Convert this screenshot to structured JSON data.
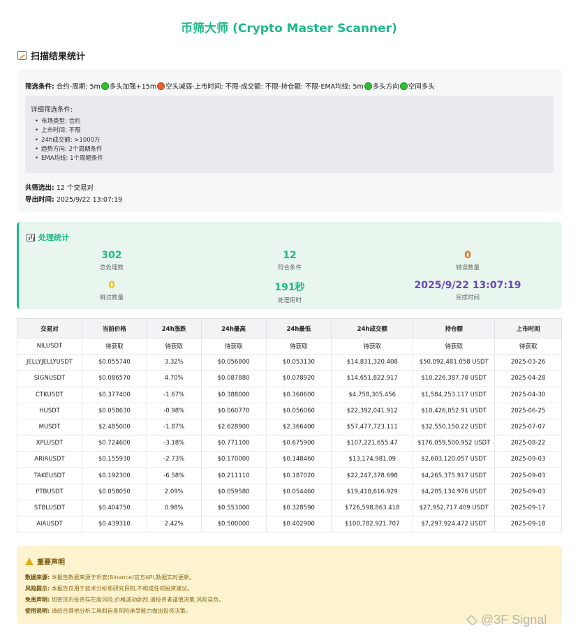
{
  "title": "币筛大师 (Crypto Master Scanner)",
  "section_title": "扫描结果统计",
  "filter": {
    "label": "筛选条件:",
    "part1": " 合约-周期: 5m",
    "part2": "多头加强+15m",
    "part3": "空头减弱-上市时间: 不限-成交额: 不限-持仓额: 不限-EMA均线: 5m",
    "part4": "多头方向",
    "part5": "空间多头"
  },
  "detail": {
    "title": "详细筛选条件:",
    "items": [
      "市场类型: 合约",
      "上市时间: 不限",
      "24h成交额: >1000万",
      "趋势方向: 2个周期条件",
      "EMA均线: 1个周期条件"
    ]
  },
  "summary": {
    "total_label": "共筛选出:",
    "total_value": " 12 个交易对",
    "export_label": "导出时间:",
    "export_value": " 2025/9/22 13:07:19"
  },
  "processing": {
    "title": "处理统计",
    "metrics": [
      {
        "value": "302",
        "label": "总处理数",
        "color": "#1db98a"
      },
      {
        "value": "12",
        "label": "符合条件",
        "color": "#1db98a"
      },
      {
        "value": "0",
        "label": "错误数量",
        "color": "#e0701e"
      },
      {
        "value": "0",
        "label": "跳过数量",
        "color": "#f0c419"
      },
      {
        "value": "191秒",
        "label": "处理用时",
        "color": "#1db98a"
      },
      {
        "value": "2025/9/22 13:07:19",
        "label": "完成时间",
        "color": "#6a47b8"
      }
    ]
  },
  "table": {
    "headers": [
      "交易对",
      "当前价格",
      "24h涨跌",
      "24h最高",
      "24h最低",
      "24h成交额",
      "持仓额",
      "上市时间"
    ],
    "rows": [
      [
        "NILUSDT",
        "待获取",
        "待获取",
        "待获取",
        "待获取",
        "待获取",
        "待获取",
        "待获取"
      ],
      [
        "JELLYJELLYUSDT",
        "$0.055740",
        "3.32%",
        "$0.056800",
        "$0.053130",
        "$14,831,320.408",
        "$50,092,481.058 USDT",
        "2025-03-26"
      ],
      [
        "SIGNUSDT",
        "$0.086570",
        "4.70%",
        "$0.087880",
        "$0.078920",
        "$14,651,822.917",
        "$10,226,387.78 USDT",
        "2025-04-28"
      ],
      [
        "CTKUSDT",
        "$0.377400",
        "-1.67%",
        "$0.388000",
        "$0.360600",
        "$4,758,305.456",
        "$1,584,253.117 USDT",
        "2025-04-30"
      ],
      [
        "HUSDT",
        "$0.058630",
        "-0.98%",
        "$0.060770",
        "$0.056060",
        "$22,392,041.912",
        "$10,426,052.91 USDT",
        "2025-06-25"
      ],
      [
        "MUSDT",
        "$2.485000",
        "-1.87%",
        "$2.628900",
        "$2.366400",
        "$57,477,723.111",
        "$32,550,150.22 USDT",
        "2025-07-07"
      ],
      [
        "XPLUSDT",
        "$0.724600",
        "-3.18%",
        "$0.771100",
        "$0.675900",
        "$107,221,655.47",
        "$176,059,500.952 USDT",
        "2025-08-22"
      ],
      [
        "ARIAUSDT",
        "$0.155930",
        "-2.73%",
        "$0.170000",
        "$0.148460",
        "$13,174,981.09",
        "$2,603,120.057 USDT",
        "2025-09-03"
      ],
      [
        "TAKEUSDT",
        "$0.192300",
        "-6.58%",
        "$0.211110",
        "$0.187020",
        "$22,247,378.698",
        "$4,265,375.917 USDT",
        "2025-09-03"
      ],
      [
        "PTBUSDT",
        "$0.058050",
        "2.09%",
        "$0.059580",
        "$0.054460",
        "$19,418,616.929",
        "$4,205,134.976 USDT",
        "2025-09-03"
      ],
      [
        "STBLUSDT",
        "$0.404750",
        "0.98%",
        "$0.553000",
        "$0.328590",
        "$726,598,863.418",
        "$27,952,717.409 USDT",
        "2025-09-17"
      ],
      [
        "AIAUSDT",
        "$0.439310",
        "2.42%",
        "$0.500000",
        "$0.402900",
        "$100,782,921.707",
        "$7,297,924.472 USDT",
        "2025-09-18"
      ]
    ]
  },
  "notice": {
    "title": "重要声明",
    "lines": [
      {
        "label": "数据来源:",
        "text": " 本报告数据来源于币安(Binance)官方API,数据实时更新。"
      },
      {
        "label": "风险提示:",
        "text": " 本报告仅用于技术分析和研究目的,不构成任何投资建议。"
      },
      {
        "label": "免责声明:",
        "text": " 加密货币投资存在高风险,价格波动剧烈,请投资者谨慎决策,风险自负。"
      },
      {
        "label": "使用说明:",
        "text": " 请结合其他分析工具和自身风险承受能力做出投资决策。"
      }
    ]
  },
  "watermark": "@3F Signal",
  "icons": {
    "section": "clipboard-chart-icon",
    "processing": "bar-chart-icon",
    "notice": "warning-icon",
    "green_dot": "green-circle-icon",
    "orange_dot": "orange-circle-icon"
  }
}
